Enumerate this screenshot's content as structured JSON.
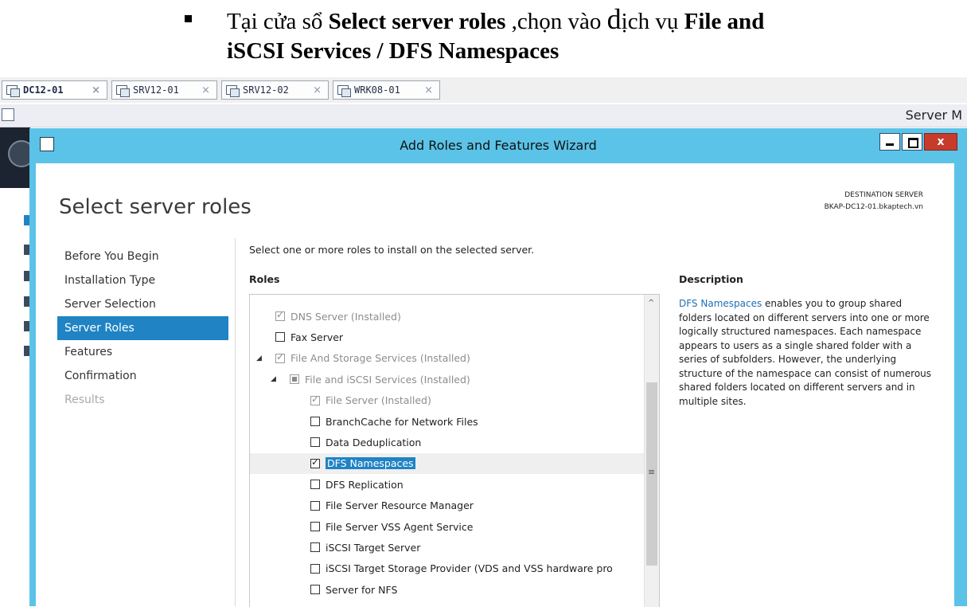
{
  "instruction": {
    "line1_prefix": "Tại cửa sổ ",
    "line1_bold1": "Select server roles",
    "line1_mid": " ,chọn vào ",
    "line1_glyph": "d",
    "line1_suffix": "ịch vụ ",
    "line1_bold2": "File and",
    "line2": "iSCSI Services / DFS Namespaces"
  },
  "vm_tabs": [
    {
      "label": "DC12-01",
      "close": "×",
      "active": true
    },
    {
      "label": "SRV12-01",
      "close": "×",
      "active": false
    },
    {
      "label": "SRV12-02",
      "close": "×",
      "active": false
    },
    {
      "label": "WRK08-01",
      "close": "×",
      "active": false
    }
  ],
  "server_manager": {
    "title": "Server M"
  },
  "wizard": {
    "title": "Add Roles and Features Wizard",
    "close_label": "x",
    "page_title": "Select server roles",
    "destination_label": "DESTINATION SERVER",
    "destination_server": "BKAP-DC12-01.bkaptech.vn",
    "steps": [
      {
        "label": "Before You Begin",
        "state": "normal"
      },
      {
        "label": "Installation Type",
        "state": "normal"
      },
      {
        "label": "Server Selection",
        "state": "normal"
      },
      {
        "label": "Server Roles",
        "state": "active"
      },
      {
        "label": "Features",
        "state": "normal"
      },
      {
        "label": "Confirmation",
        "state": "normal"
      },
      {
        "label": "Results",
        "state": "disabled"
      }
    ],
    "prompt": "Select one or more roles to install on the selected server.",
    "roles_header": "Roles",
    "description_header": "Description",
    "description_link": "DFS Namespaces",
    "description_text": " enables you to group shared folders located on different servers into one or more logically structured namespaces. Each namespace appears to users as a single shared folder with a series of subfolders. However, the underlying structure of the namespace can consist of numerous shared folders located on different servers and in multiple sites.",
    "roles": [
      {
        "label": "DNS Server (Installed)",
        "indent": 0,
        "expander": "",
        "check": "checked",
        "dim": true,
        "selected": false
      },
      {
        "label": "Fax Server",
        "indent": 0,
        "expander": "",
        "check": "unchecked",
        "dim": false,
        "selected": false
      },
      {
        "label": "File And Storage Services (Installed)",
        "indent": 0,
        "expander": "◢",
        "check": "checked",
        "dim": true,
        "selected": false
      },
      {
        "label": "File and iSCSI Services (Installed)",
        "indent": 1,
        "expander": "◢",
        "check": "partial",
        "dim": true,
        "selected": false
      },
      {
        "label": "File Server (Installed)",
        "indent": 2,
        "expander": "",
        "check": "checked",
        "dim": true,
        "selected": false
      },
      {
        "label": "BranchCache for Network Files",
        "indent": 2,
        "expander": "",
        "check": "unchecked",
        "dim": false,
        "selected": false
      },
      {
        "label": "Data Deduplication",
        "indent": 2,
        "expander": "",
        "check": "unchecked",
        "dim": false,
        "selected": false
      },
      {
        "label": "DFS Namespaces",
        "indent": 2,
        "expander": "",
        "check": "checked",
        "dim": false,
        "selected": true
      },
      {
        "label": "DFS Replication",
        "indent": 2,
        "expander": "",
        "check": "unchecked",
        "dim": false,
        "selected": false
      },
      {
        "label": "File Server Resource Manager",
        "indent": 2,
        "expander": "",
        "check": "unchecked",
        "dim": false,
        "selected": false
      },
      {
        "label": "File Server VSS Agent Service",
        "indent": 2,
        "expander": "",
        "check": "unchecked",
        "dim": false,
        "selected": false
      },
      {
        "label": "iSCSI Target Server",
        "indent": 2,
        "expander": "",
        "check": "unchecked",
        "dim": false,
        "selected": false
      },
      {
        "label": "iSCSI Target Storage Provider (VDS and VSS hardware pro",
        "indent": 2,
        "expander": "",
        "check": "unchecked",
        "dim": false,
        "selected": false
      },
      {
        "label": "Server for NFS",
        "indent": 2,
        "expander": "",
        "check": "unchecked",
        "dim": false,
        "selected": false
      }
    ]
  }
}
